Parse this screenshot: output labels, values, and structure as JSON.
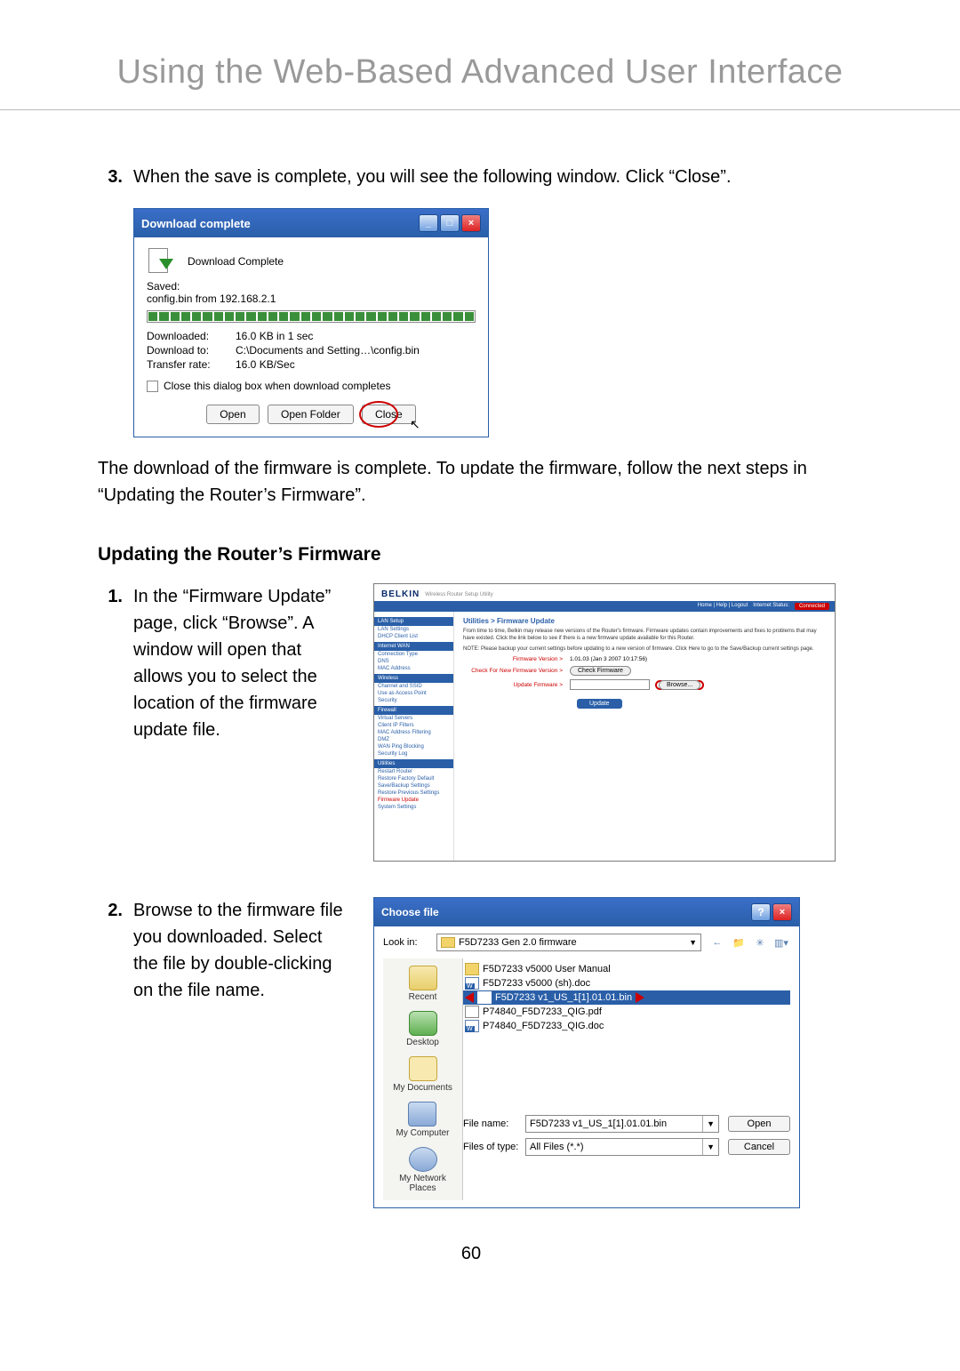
{
  "page_title": "Using the Web-Based Advanced User Interface",
  "step3": {
    "num": "3.",
    "text": "When the save is complete, you will see the following window. Click “Close”."
  },
  "download_dialog": {
    "title": "Download complete",
    "heading": "Download Complete",
    "saved_label": "Saved:",
    "saved_value": "config.bin from 192.168.2.1",
    "rows": {
      "downloaded_label": "Downloaded:",
      "downloaded_value": "16.0 KB in 1 sec",
      "download_to_label": "Download to:",
      "download_to_value": "C:\\Documents and Setting…\\config.bin",
      "rate_label": "Transfer rate:",
      "rate_value": "16.0 KB/Sec"
    },
    "checkbox": "Close this dialog box when download completes",
    "buttons": {
      "open": "Open",
      "open_folder": "Open Folder",
      "close": "Close"
    }
  },
  "after_download": "The download of the firmware is complete. To update the firmware, follow the next steps in “Updating the Router’s Firmware”.",
  "section_heading": "Updating the Router’s Firmware",
  "step1": {
    "num": "1.",
    "text": "In the “Firmware Update” page, click “Browse”. A window will open that allows you to select the location of the firmware update file."
  },
  "belkin": {
    "logo": "BELKIN",
    "sub": "Wireless Router Setup Utility",
    "bar": {
      "links": "Home | Help | Logout",
      "internet": "Internet Status:",
      "logout": "Connected"
    },
    "side": {
      "h1": "LAN Setup",
      "i1a": "LAN Settings",
      "i1b": "DHCP Client List",
      "h2": "Internet WAN",
      "i2a": "Connection Type",
      "i2b": "DNS",
      "i2c": "MAC Address",
      "h3": "Wireless",
      "i3a": "Channel and SSID",
      "i3b": "Use as Access Point",
      "i3c": "Security",
      "h4": "Firewall",
      "i4a": "Virtual Servers",
      "i4b": "Client IP Filters",
      "i4c": "MAC Address Filtering",
      "i4d": "DMZ",
      "i4e": "WAN Ping Blocking",
      "i4f": "Security Log",
      "h5": "Utilities",
      "i5a": "Restart Router",
      "i5b": "Restore Factory Default",
      "i5c": "Save/Backup Settings",
      "i5d": "Restore Previous Settings",
      "i5e": "Firmware Update",
      "i5f": "System Settings"
    },
    "content": {
      "title": "Utilities > Firmware Update",
      "p1": "From time to time, Belkin may release new versions of the Router's firmware. Firmware updates contain improvements and fixes to problems that may have existed. Click the link below to see if there is a new firmware update available for this Router.",
      "p2": "NOTE: Please backup your current settings before updating to a new version of firmware. Click Here to go to the Save/Backup current settings page.",
      "row1_label": "Firmware Version >",
      "row1_val": "1.01.03 (Jan 3 2007 10:17:56)",
      "row2_label": "Check For New Firmware Version >",
      "row2_btn": "Check Firmware",
      "row3_label": "Update Firmware >",
      "row3_btn": "Browse...",
      "update_btn": "Update"
    }
  },
  "step2": {
    "num": "2.",
    "text": "Browse to the firmware file you downloaded. Select the file by double-clicking on the file name."
  },
  "choose": {
    "title": "Choose file",
    "lookin_label": "Look in:",
    "lookin_value": "F5D7233 Gen 2.0 firmware",
    "places": {
      "recent": "Recent",
      "desktop": "Desktop",
      "documents": "My Documents",
      "computer": "My Computer",
      "network": "My Network Places"
    },
    "files": {
      "f1": "F5D7233 v5000 User Manual",
      "f2": "F5D7233 v5000 (sh).doc",
      "f3": "F5D7233 v1_US_1[1].01.01.bin",
      "f4": "P74840_F5D7233_QIG.pdf",
      "f5": "P74840_F5D7233_QIG.doc"
    },
    "filename_label": "File name:",
    "filename_value": "F5D7233 v1_US_1[1].01.01.bin",
    "filetype_label": "Files of type:",
    "filetype_value": "All Files (*.*)",
    "open": "Open",
    "cancel": "Cancel"
  },
  "page_number": "60"
}
